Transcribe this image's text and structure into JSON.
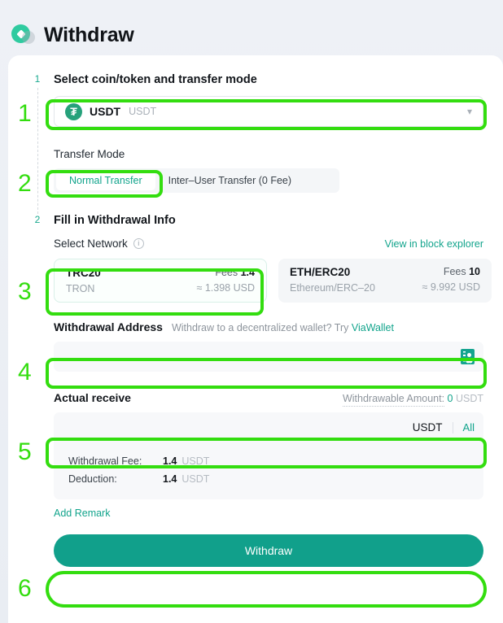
{
  "header": {
    "title": "Withdraw",
    "logo_icon": "mexc-diamond-logo"
  },
  "steps": [
    {
      "number": "1",
      "heading": "Select coin/token and transfer mode"
    },
    {
      "number": "2",
      "heading": "Fill in Withdrawal Info"
    }
  ],
  "coin_select": {
    "icon": "usdt-tether-icon",
    "icon_glyph": "₮",
    "symbol": "USDT",
    "name": "USDT",
    "chevron_icon": "chevron-down-icon"
  },
  "transfer_mode": {
    "label": "Transfer Mode",
    "tabs": [
      {
        "label": "Normal Transfer",
        "selected": true
      },
      {
        "label": "Inter–User Transfer (0 Fee)",
        "selected": false
      }
    ]
  },
  "network": {
    "label": "Select Network",
    "info_icon": "info-circle-icon",
    "explorer_link": "View in block explorer",
    "cards": [
      {
        "name": "TRC20",
        "sub": "TRON",
        "fee_prefix": "Fees",
        "fee_value": "1.4",
        "usd": "≈ 1.398 USD",
        "selected": true
      },
      {
        "name": "ETH/ERC20",
        "sub": "Ethereum/ERC–20",
        "fee_prefix": "Fees",
        "fee_value": "10",
        "usd": "≈ 9.992 USD",
        "selected": false
      }
    ]
  },
  "address": {
    "label": "Withdrawal Address",
    "hint_prefix": "Withdraw to a decentralized wallet? Try ",
    "hint_link": "ViaWallet",
    "value": "",
    "placeholder": "",
    "book_icon": "address-book-icon"
  },
  "actual_receive": {
    "label": "Actual receive",
    "withdrawable_label": "Withdrawable Amount:",
    "withdrawable_value": "0",
    "withdrawable_unit": "USDT",
    "amount_value": "",
    "amount_placeholder": "",
    "unit": "USDT",
    "all_label": "All",
    "fees": [
      {
        "key": "Withdrawal Fee:",
        "value": "1.4",
        "unit": "USDT"
      },
      {
        "key": "Deduction:",
        "value": "1.4",
        "unit": "USDT"
      }
    ]
  },
  "add_remark": "Add Remark",
  "submit": {
    "label": "Withdraw"
  },
  "annotations": [
    {
      "number": "1"
    },
    {
      "number": "2"
    },
    {
      "number": "3"
    },
    {
      "number": "4"
    },
    {
      "number": "5"
    },
    {
      "number": "6"
    }
  ],
  "colors": {
    "accent_teal": "#12a48c",
    "button_teal": "#11a08b",
    "annotation_green": "#33dd0f",
    "usdt_green": "#26A17B"
  }
}
